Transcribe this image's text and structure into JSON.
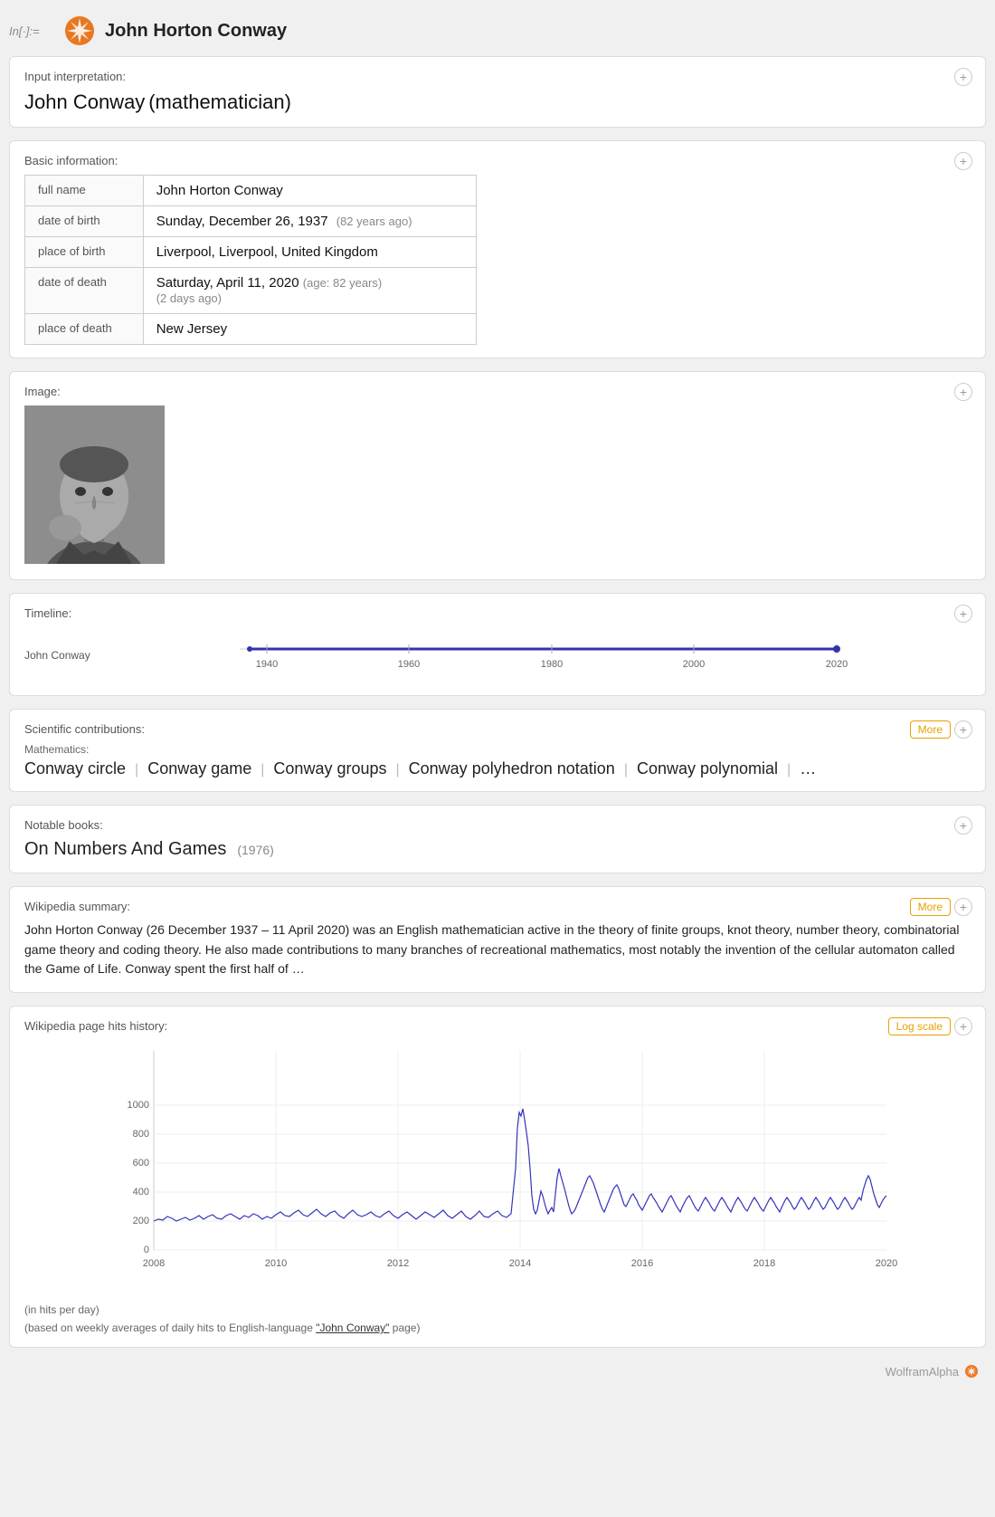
{
  "header": {
    "label": "In[·]:=",
    "title": "John Horton Conway"
  },
  "input_card": {
    "section_label": "Input interpretation:",
    "name": "John Conway",
    "note": "(mathematician)"
  },
  "basic_info": {
    "section_label": "Basic information:",
    "rows": [
      {
        "field": "full name",
        "value": "John Horton Conway",
        "extra": ""
      },
      {
        "field": "date of birth",
        "value": "Sunday, December 26, 1937",
        "extra": "(82 years ago)"
      },
      {
        "field": "place of birth",
        "value": "Liverpool, Liverpool, United Kingdom",
        "extra": ""
      },
      {
        "field": "date of death",
        "value": "Saturday, April 11, 2020",
        "extra_age": "(age: 82 years)",
        "extra_days": "(2 days ago)"
      },
      {
        "field": "place of death",
        "value": "New Jersey",
        "extra": ""
      }
    ]
  },
  "image_card": {
    "section_label": "Image:",
    "alt": "John Horton Conway photo"
  },
  "timeline_card": {
    "section_label": "Timeline:",
    "person_label": "John Conway",
    "years": [
      "1940",
      "1960",
      "1980",
      "2000",
      "2020"
    ],
    "start_year": 1937,
    "end_year": 2020
  },
  "contributions_card": {
    "section_label": "Scientific contributions:",
    "more_label": "More",
    "sub_label": "Mathematics:",
    "items": [
      "Conway circle",
      "Conway game",
      "Conway groups",
      "Conway polyhedron notation",
      "Conway polynomial",
      "…"
    ]
  },
  "books_card": {
    "section_label": "Notable books:",
    "title": "On Numbers And Games",
    "year": "(1976)"
  },
  "wiki_card": {
    "section_label": "Wikipedia summary:",
    "more_label": "More",
    "text": "John Horton Conway (26 December 1937 – 11 April 2020) was an English mathematician active in the theory of finite groups, knot theory, number theory, combinatorial game theory and coding theory. He also made contributions to many branches of recreational mathematics, most notably the invention of the cellular automaton called the Game of Life. Conway spent the first half of …"
  },
  "hits_card": {
    "section_label": "Wikipedia page hits history:",
    "log_scale_label": "Log scale",
    "y_axis": [
      "0",
      "200",
      "400",
      "600",
      "800",
      "1000"
    ],
    "x_axis": [
      "2008",
      "2010",
      "2012",
      "2014",
      "2016",
      "2018",
      "2020"
    ],
    "note1": "(in hits per day)",
    "note2": "(based on weekly averages of daily hits to English-language \"John Conway\" page)"
  },
  "footer": {
    "brand": "WolframAlpha"
  }
}
